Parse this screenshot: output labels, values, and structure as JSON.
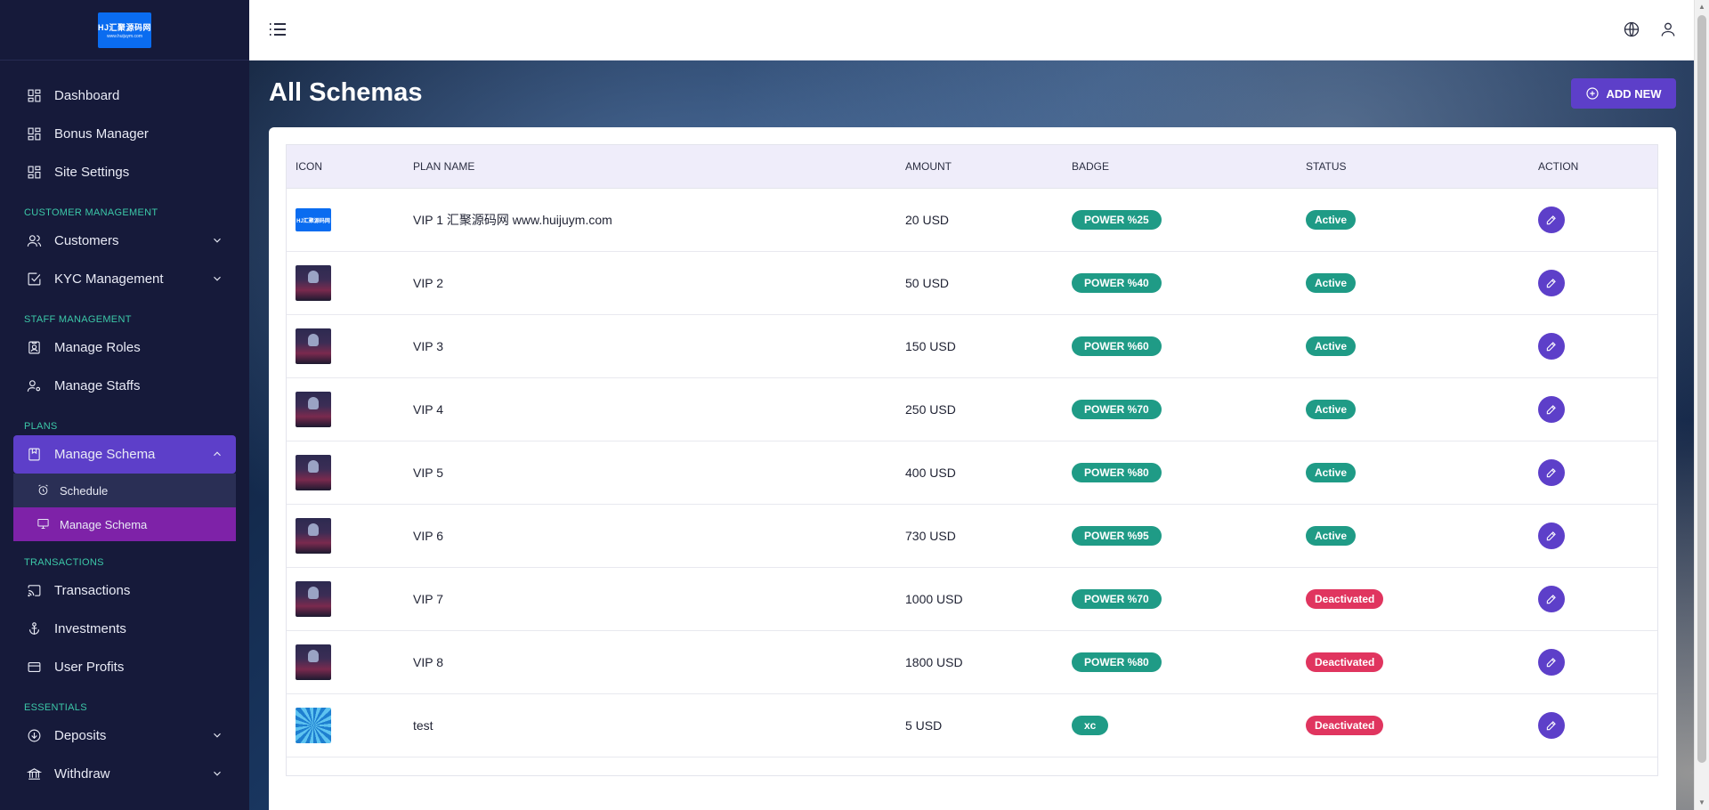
{
  "logo": {
    "line1": "HJ汇聚源码网",
    "line2": "www.huijuym.com"
  },
  "sidebar": {
    "top_items": [
      {
        "label": "Dashboard",
        "icon": "grid-icon"
      },
      {
        "label": "Bonus Manager",
        "icon": "grid-icon"
      },
      {
        "label": "Site Settings",
        "icon": "grid-icon"
      }
    ],
    "sections": {
      "customer": {
        "label": "CUSTOMER MANAGEMENT",
        "items": [
          {
            "label": "Customers"
          },
          {
            "label": "KYC Management"
          }
        ]
      },
      "staff": {
        "label": "STAFF MANAGEMENT",
        "items": [
          {
            "label": "Manage Roles"
          },
          {
            "label": "Manage Staffs"
          }
        ]
      },
      "plans": {
        "label": "PLANS",
        "items": [
          {
            "label": "Manage Schema"
          }
        ],
        "sub_items": [
          {
            "label": "Schedule"
          },
          {
            "label": "Manage Schema"
          }
        ]
      },
      "transactions": {
        "label": "TRANSACTIONS",
        "items": [
          {
            "label": "Transactions"
          },
          {
            "label": "Investments"
          },
          {
            "label": "User Profits"
          }
        ]
      },
      "essentials": {
        "label": "ESSENTIALS",
        "items": [
          {
            "label": "Deposits"
          },
          {
            "label": "Withdraw"
          }
        ]
      }
    }
  },
  "page": {
    "title": "All Schemas",
    "add_button": "ADD NEW"
  },
  "table": {
    "headers": {
      "icon": "ICON",
      "plan_name": "PLAN NAME",
      "amount": "AMOUNT",
      "badge": "BADGE",
      "status": "STATUS",
      "action": "ACTION"
    },
    "rows": [
      {
        "thumb": "logo",
        "thumb_text": "HJ汇聚源码网",
        "plan_name": "VIP 1 汇聚源码网 www.huijuym.com",
        "amount": "20 USD",
        "badge": "POWER %25",
        "status": "Active",
        "status_type": "active"
      },
      {
        "thumb": "robot",
        "plan_name": "VIP 2",
        "amount": "50 USD",
        "badge": "POWER %40",
        "status": "Active",
        "status_type": "active"
      },
      {
        "thumb": "robot",
        "plan_name": "VIP 3",
        "amount": "150 USD",
        "badge": "POWER %60",
        "status": "Active",
        "status_type": "active"
      },
      {
        "thumb": "robot",
        "plan_name": "VIP 4",
        "amount": "250 USD",
        "badge": "POWER %70",
        "status": "Active",
        "status_type": "active"
      },
      {
        "thumb": "robot",
        "plan_name": "VIP 5",
        "amount": "400 USD",
        "badge": "POWER %80",
        "status": "Active",
        "status_type": "active"
      },
      {
        "thumb": "robot",
        "plan_name": "VIP 6",
        "amount": "730 USD",
        "badge": "POWER %95",
        "status": "Active",
        "status_type": "active"
      },
      {
        "thumb": "robot",
        "plan_name": "VIP 7",
        "amount": "1000 USD",
        "badge": "POWER %70",
        "status": "Deactivated",
        "status_type": "deactivated"
      },
      {
        "thumb": "robot",
        "plan_name": "VIP 8",
        "amount": "1800 USD",
        "badge": "POWER %80",
        "status": "Deactivated",
        "status_type": "deactivated"
      },
      {
        "thumb": "swirl",
        "plan_name": "test",
        "amount": "5 USD",
        "badge": "xc",
        "status": "Deactivated",
        "status_type": "deactivated"
      }
    ]
  },
  "colors": {
    "sidebar_bg": "#161a3a",
    "accent": "#5d3fc9",
    "sub_active": "#7e22a8",
    "success": "#1f9b86",
    "danger": "#e0355f",
    "section_label": "#3cc8a8"
  }
}
